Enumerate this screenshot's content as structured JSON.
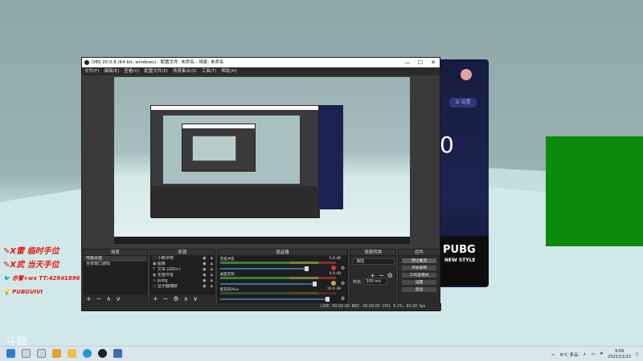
{
  "obs": {
    "title": "OBS 25.0.8 (64-bit, windows) - 配置文件: 未命名 - 场景: 未命名",
    "window_controls": {
      "minimize": "—",
      "maximize": "☐",
      "close": "✕"
    },
    "menu": [
      "文件(F)",
      "编辑(E)",
      "查看(V)",
      "配置文件(P)",
      "场景集合(S)",
      "工具(T)",
      "帮助(H)"
    ],
    "docks": {
      "scenes": {
        "header": "场景",
        "items": [
          "电脑桌面",
          "全体窗口游戏"
        ]
      },
      "sources": {
        "header": "来源",
        "items": [
          {
            "icon": "▢",
            "label": "小鹅冰吧"
          },
          {
            "icon": "▣",
            "label": "图像"
          },
          {
            "icon": "T",
            "label": "文本 (GDI+)"
          },
          {
            "icon": "◉",
            "label": "无窗冲音"
          },
          {
            "icon": "∞",
            "label": "pubg"
          },
          {
            "icon": "▭",
            "label": "显示器捕获"
          }
        ]
      },
      "mixer": {
        "header": "混音器",
        "channels": [
          {
            "name": "无窗冲音",
            "db": "-5.8 dB"
          },
          {
            "name": "桌面音频",
            "db": "0.0 dB"
          },
          {
            "name": "麦克风/Aux",
            "db": "10.0 dB"
          }
        ]
      },
      "transitions": {
        "header": "场景转换",
        "selected": "渐隐",
        "duration_label": "时长",
        "duration_value": "300 ms"
      },
      "controls": {
        "header": "控件",
        "buttons": [
          "停止推流",
          "开始录制",
          "工作室模式",
          "设置",
          "退出"
        ]
      }
    },
    "statusbar": "LIVE: 00:00:00   REC: 00:00:00   CPU: 0.2%, 60.00 fps"
  },
  "phone_panel": {
    "pill_label": "☰ 设置",
    "big_number": "0",
    "pubg_logo": "PUBG",
    "pubg_sub": "NEW STYLE"
  },
  "overlay": {
    "line1": "✎X雷 临时手位",
    "line2": "✎X武 当天手位",
    "line3": "🐦 赤警+wx TT:429#1896",
    "line4": "💡 PUBGVIVI",
    "watermark": "斗鱼"
  },
  "taskbar": {
    "weather": "9°C 多云",
    "time": "9:09",
    "date": "2021/11/13"
  }
}
